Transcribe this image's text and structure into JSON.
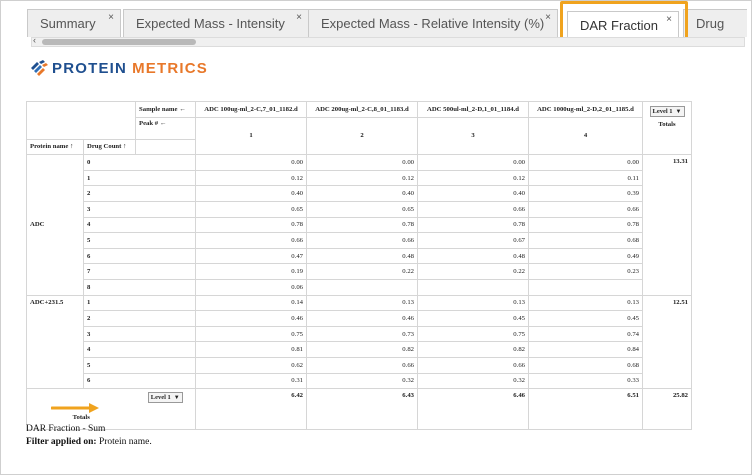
{
  "tabs": [
    {
      "label": "Summary",
      "close": "×"
    },
    {
      "label": "Expected Mass - Intensity",
      "close": "×"
    },
    {
      "label": "Expected Mass - Relative Intensity (%)",
      "close": "×"
    },
    {
      "label": "DAR Fraction",
      "close": "×"
    },
    {
      "label": "Drug"
    }
  ],
  "scrollbar": {
    "left_arrow": "‹"
  },
  "logo": {
    "part1": "PROTEIN",
    "part2": "METRICS"
  },
  "table": {
    "sample_name_label": "Sample name ←",
    "peak_label": "Peak # ←",
    "protein_name_header": "Protein name ↑",
    "drug_count_header": "Drug Count ↑",
    "level_dropdown": "Level 1",
    "totals_header": "Totals",
    "samples": [
      "ADC 100ug-ml_2-C,7_01_1182.d",
      "ADC 200ug-ml_2-C,8_01_1183.d",
      "ADC 500ul-ml_2-D,1_01_1184.d",
      "ADC 1000ug-ml_2-D,2_01_1185.d"
    ],
    "peaks": [
      "1",
      "2",
      "3",
      "4"
    ],
    "groups": [
      {
        "protein": "ADC",
        "total": "13.31",
        "rows": [
          {
            "count": "0",
            "values": [
              "0.00",
              "0.00",
              "0.00",
              "0.00"
            ]
          },
          {
            "count": "1",
            "values": [
              "0.12",
              "0.12",
              "0.12",
              "0.11"
            ]
          },
          {
            "count": "2",
            "values": [
              "0.40",
              "0.40",
              "0.40",
              "0.39"
            ]
          },
          {
            "count": "3",
            "values": [
              "0.65",
              "0.65",
              "0.66",
              "0.66"
            ]
          },
          {
            "count": "4",
            "values": [
              "0.78",
              "0.78",
              "0.78",
              "0.78"
            ]
          },
          {
            "count": "5",
            "values": [
              "0.66",
              "0.66",
              "0.67",
              "0.68"
            ]
          },
          {
            "count": "6",
            "values": [
              "0.47",
              "0.48",
              "0.48",
              "0.49"
            ]
          },
          {
            "count": "7",
            "values": [
              "0.19",
              "0.22",
              "0.22",
              "0.23"
            ]
          },
          {
            "count": "8",
            "values": [
              "0.06",
              "",
              "",
              ""
            ]
          }
        ]
      },
      {
        "protein": "ADC+231.5",
        "total": "12.51",
        "rows": [
          {
            "count": "1",
            "values": [
              "0.14",
              "0.13",
              "0.13",
              "0.13"
            ]
          },
          {
            "count": "2",
            "values": [
              "0.46",
              "0.46",
              "0.45",
              "0.45"
            ]
          },
          {
            "count": "3",
            "values": [
              "0.75",
              "0.73",
              "0.75",
              "0.74"
            ]
          },
          {
            "count": "4",
            "values": [
              "0.81",
              "0.82",
              "0.82",
              "0.84"
            ]
          },
          {
            "count": "5",
            "values": [
              "0.62",
              "0.66",
              "0.66",
              "0.68"
            ]
          },
          {
            "count": "6",
            "values": [
              "0.31",
              "0.32",
              "0.32",
              "0.33"
            ]
          }
        ]
      }
    ],
    "totals_row": {
      "label": "Totals",
      "level_dropdown": "Level 1",
      "values": [
        "6.42",
        "6.43",
        "6.46",
        "6.51"
      ],
      "grand_total": "25.82"
    }
  },
  "footer": {
    "line1": "DAR Fraction - Sum",
    "filter_label": "Filter applied on:",
    "filter_value": "Protein name."
  },
  "colors": {
    "highlight": "#f0a31e",
    "logo_blue": "#1f4f8f",
    "logo_orange": "#e8782a"
  }
}
